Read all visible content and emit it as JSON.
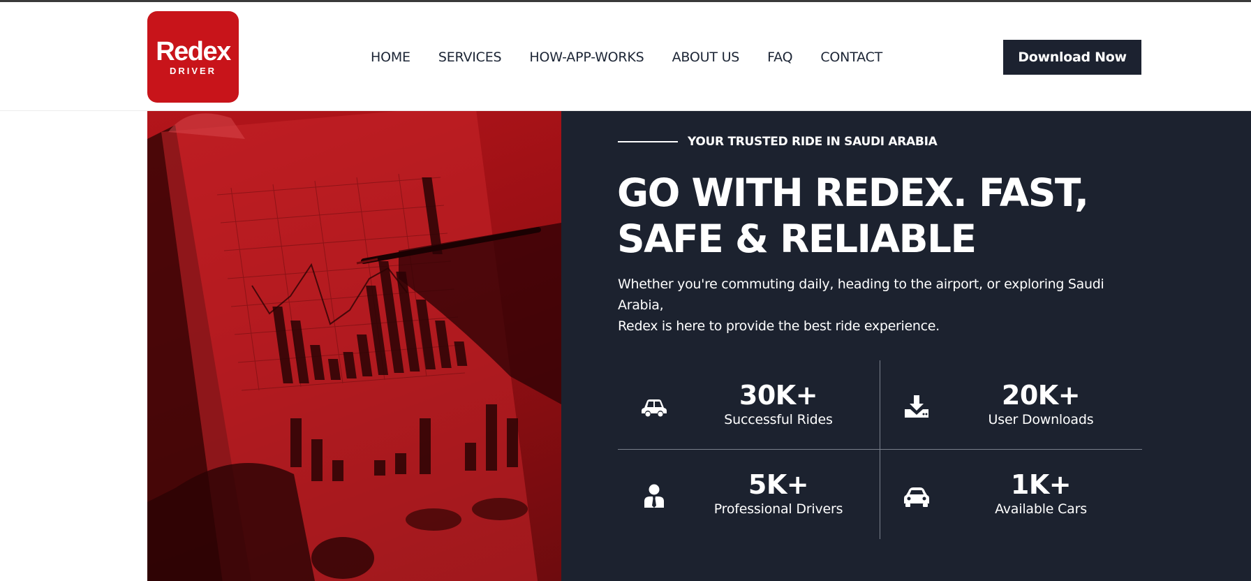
{
  "brand": {
    "logo_word": "Redex",
    "logo_sub": "DRIVER",
    "color": "#c8141a"
  },
  "nav": {
    "items": [
      {
        "label": "HOME"
      },
      {
        "label": "SERVICES"
      },
      {
        "label": "HOW-APP-WORKS"
      },
      {
        "label": "ABOUT US"
      },
      {
        "label": "FAQ"
      },
      {
        "label": "CONTACT"
      }
    ],
    "download_label": "Download Now"
  },
  "hero": {
    "eyebrow": "YOUR TRUSTED RIDE IN SAUDI ARABIA",
    "title_line1": "GO WITH REDEX. FAST,",
    "title_line2": "SAFE & RELIABLE",
    "description_line1": "Whether you're commuting daily, heading to the airport, or exploring Saudi Arabia,",
    "description_line2": "Redex is here to provide the best ride experience.",
    "background": "#1c222f"
  },
  "stats": [
    {
      "icon": "car-side-icon",
      "value": "30K+",
      "label": "Successful Rides"
    },
    {
      "icon": "download-icon",
      "value": "20K+",
      "label": "User Downloads"
    },
    {
      "icon": "driver-icon",
      "value": "5K+",
      "label": "Professional Drivers"
    },
    {
      "icon": "car-front-icon",
      "value": "1K+",
      "label": "Available Cars"
    }
  ]
}
